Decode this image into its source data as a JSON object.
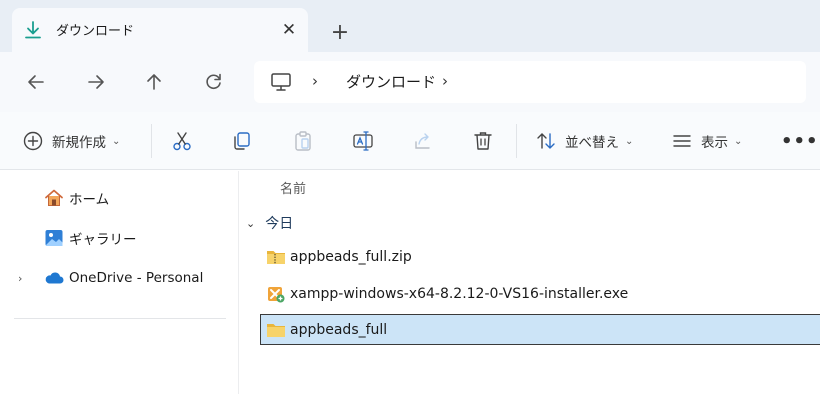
{
  "tab": {
    "title": "ダウンロード",
    "close_glyph": "✕",
    "new_tab_glyph": "+"
  },
  "address_bar": {
    "current_folder": "ダウンロード"
  },
  "command_bar": {
    "new_label": "新規作成",
    "sort_label": "並べ替え",
    "view_label": "表示",
    "more_glyph": "•••"
  },
  "sidebar": {
    "items": [
      {
        "label": "ホーム",
        "icon": "home-icon"
      },
      {
        "label": "ギャラリー",
        "icon": "gallery-icon"
      },
      {
        "label": "OneDrive - Personal",
        "icon": "onedrive-cloud-icon",
        "expandable": true
      }
    ]
  },
  "file_list": {
    "column_name": "名前",
    "group_label": "今日",
    "items": [
      {
        "name": "appbeads_full.zip",
        "icon": "zip-folder-icon",
        "selected": false
      },
      {
        "name": "xampp-windows-x64-8.2.12-0-VS16-installer.exe",
        "icon": "installer-exe-icon",
        "selected": false
      },
      {
        "name": "appbeads_full",
        "icon": "folder-icon",
        "selected": true
      }
    ]
  },
  "colors": {
    "accent": "#0078d4",
    "selection": "#cce4f7",
    "folder": "#f4c24e",
    "tabstrip": "#e8eef5"
  }
}
